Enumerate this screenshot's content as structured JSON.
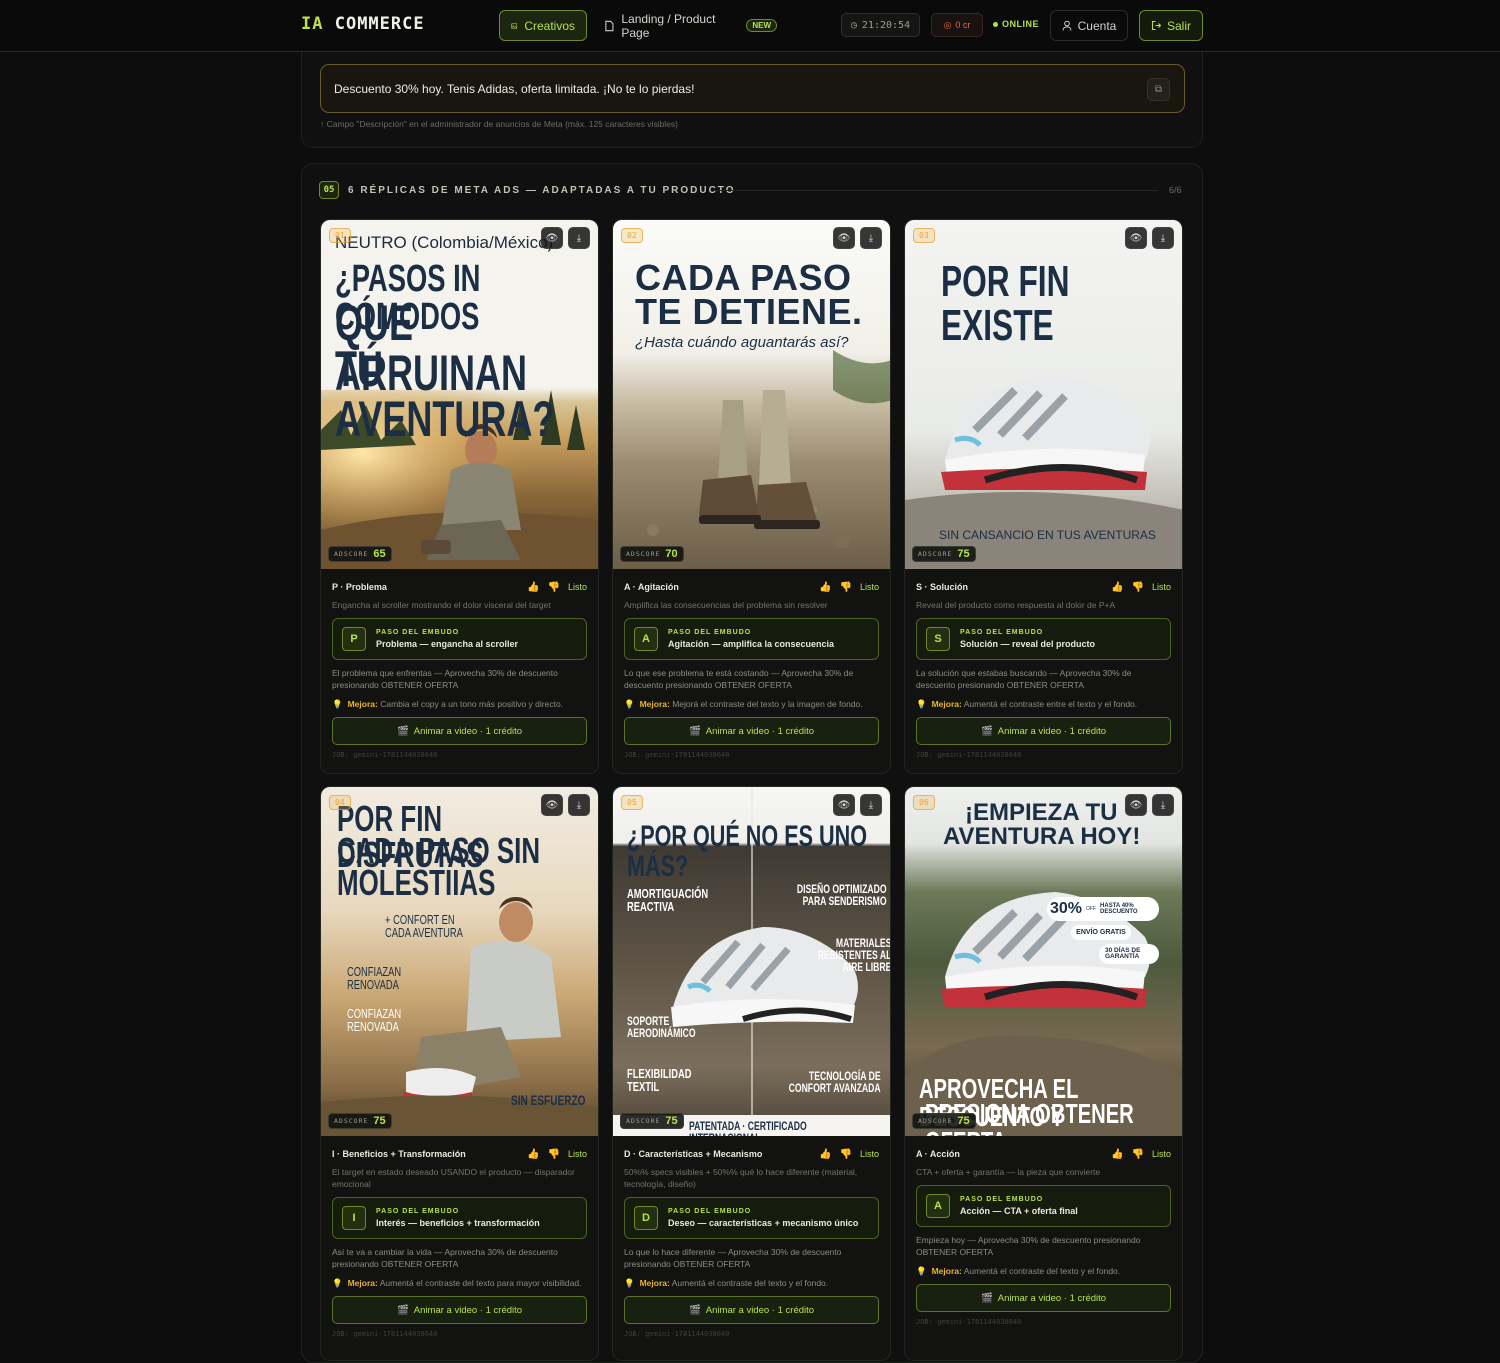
{
  "header": {
    "logo_ia": "IA",
    "logo_rest": " COMMERCE",
    "nav_creativos": "Creativos",
    "nav_landing": "Landing / Product Page",
    "badge_new": "NEW",
    "clock": "21:20:54",
    "credits": "0 cr",
    "status": "ONLINE",
    "account": "Cuenta",
    "logout": "Salir",
    "colors": {
      "accent": "#b6e24f",
      "bg": "#0c0d0c",
      "warn": "#e06a50"
    }
  },
  "description": {
    "text": "Descuento 30% hoy. Tenis Adidas, oferta limitada. ¡No te lo pierdas!",
    "note": "↑ Campo \"Descripción\" en el administrador de anuncios de Meta (máx. 125 caracteres visibles)"
  },
  "section": {
    "number": "05",
    "title": "6 RÉPLICAS DE META ADS — ADAPTADAS A TU PRODUCTO",
    "count": "6/6"
  },
  "common": {
    "adscore_label": "ADSCORE",
    "listo": "Listo",
    "paso_label": "PASO DEL EMBUDO",
    "mejora_label": "Mejora:",
    "animar": "Animar a video · 1 crédito",
    "job": "JOB: gemini-1781144038640"
  },
  "cards": [
    {
      "num": "01",
      "adscore": "65",
      "headline1": "NEUTRO (Colombia/México)",
      "headline2": "¿PASOS IN CÓMODOS",
      "headline3": "QUE ARRUINAN",
      "headline4": "TÚ AVENTURA?",
      "stage": "P · Problema",
      "sub": "Engancha al scroller mostrando el dolor visceral del target",
      "letter": "P",
      "funnel": "Problema — engancha al scroller",
      "copy": "El problema que enfrentas — Aprovecha 30% de descuento presionando OBTENER OFERTA",
      "mejora": "Cambia el copy a un tono más positivo y directo."
    },
    {
      "num": "02",
      "adscore": "70",
      "headline1": "CADA PASO",
      "headline2": "TE DETIENE.",
      "headline3": "¿Hasta cuándo aguantarás así?",
      "stage": "A · Agitación",
      "sub": "Amplifica las consecuencias del problema sin resolver",
      "letter": "A",
      "funnel": "Agitación — amplifica la consecuencia",
      "copy": "Lo que ese problema te está costando — Aprovecha 30% de descuento presionando OBTENER OFERTA",
      "mejora": "Mejorá el contraste del texto y la imagen de fondo."
    },
    {
      "num": "03",
      "adscore": "75",
      "headline1": "POR FIN EXISTE",
      "headline2": "SIN CANSANCIO EN TUS AVENTURAS",
      "stage": "S · Solución",
      "sub": "Reveal del producto como respuesta al dolor de P+A",
      "letter": "S",
      "funnel": "Solución — reveal del producto",
      "copy": "La solución que estabas buscando — Aprovecha 30% de descuento presionando OBTENER OFERTA",
      "mejora": "Aumentá el contraste entre el texto y el fondo."
    },
    {
      "num": "04",
      "adscore": "75",
      "headline1": "POR FIN DISFRUTAS",
      "headline2": "CADA PASO SIN",
      "headline3": "MOLESTIIAS",
      "tag1": "+ CONFORT EN CADA AVENTURA",
      "tag2": "CONFIAZAN RENOVADA",
      "tag3": "CONFIAZAN RENOVADA",
      "tag4": "SIN ESFUERZO",
      "stage": "I · Beneficios + Transformación",
      "sub": "El target en estado deseado USANDO el producto — disparador emocional",
      "letter": "I",
      "funnel": "Interés — beneficios + transformación",
      "copy": "Así te va a cambiar la vida — Aprovecha 30% de descuento presionando OBTENER OFERTA",
      "mejora": "Aumentá el contraste del texto para mayor visibilidad."
    },
    {
      "num": "05",
      "adscore": "75",
      "headline1": "¿POR QUÉ NO ES UNO MÁS?",
      "f1": "AMORTIGUACIÓN REACTIVA",
      "f2": "DISEÑO OPTIMIZADO PARA SENDERISMO",
      "f3": "MATERIALES RESISTENTES AL AIRE LIBRE",
      "f4": "SOPORTE AERODINÁMICO",
      "f5": "FLEXIBILIDAD TEXTIL",
      "f6": "TECNOLOGÍA DE CONFORT AVANZADA",
      "footer": "PATENTADA · CERTIFICADO INTERNACIONAL",
      "stage": "D · Características + Mecanismo",
      "sub": "50%% specs visibles + 50%% qué lo hace diferente (material, tecnología, diseño)",
      "letter": "D",
      "funnel": "Deseo — características + mecanismo único",
      "copy": "Lo que lo hace diferente — Aprovecha 30% de descuento presionando OBTENER OFERTA",
      "mejora": "Aumentá el contraste del texto y el fondo."
    },
    {
      "num": "06",
      "adscore": "75",
      "headline1": "¡EMPIEZA TU",
      "headline2": "AVENTURA HOY!",
      "badge1_big": "30%",
      "badge1_off": "OFF",
      "badge1_small": "HASTA 40% DESCUENTO",
      "badge2": "ENVÍO GRATIS",
      "badge3": "30 DÍAS DE GARANTÍA",
      "cta1": "APROVECHA EL DESCUENTO Y",
      "cta2": "PRESIONA OBTENER OFERTA",
      "stage": "A · Acción",
      "sub": "CTA + oferta + garantía — la pieza que convierte",
      "letter": "A",
      "funnel": "Acción — CTA + oferta final",
      "copy": "Empieza hoy — Aprovecha 30% de descuento presionando OBTENER OFERTA",
      "mejora": "Aumentá el contraste del texto y el fondo."
    }
  ]
}
